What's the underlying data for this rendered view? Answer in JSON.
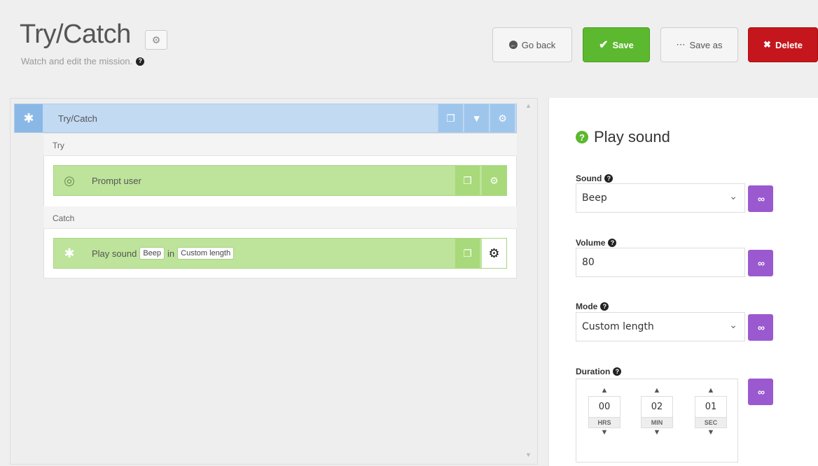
{
  "header": {
    "title": "Try/Catch",
    "subtitle": "Watch and edit the mission.",
    "buttons": {
      "go_back": "Go back",
      "save": "Save",
      "save_as": "Save as",
      "delete": "Delete"
    }
  },
  "mission": {
    "block_title": "Try/Catch",
    "try_label": "Try",
    "catch_label": "Catch",
    "try_action": "Prompt user",
    "catch_action": {
      "label": "Play sound",
      "sound_pill": "Beep",
      "joiner": "in",
      "mode_pill": "Custom length"
    }
  },
  "panel": {
    "title": "Play sound",
    "sound": {
      "label": "Sound",
      "value": "Beep"
    },
    "volume": {
      "label": "Volume",
      "value": "80"
    },
    "mode": {
      "label": "Mode",
      "value": "Custom length"
    },
    "duration": {
      "label": "Duration",
      "hrs": "00",
      "hrs_unit": "HRS",
      "min": "02",
      "min_unit": "MIN",
      "sec": "01",
      "sec_unit": "SEC"
    }
  },
  "colors": {
    "save": "#5cb82e",
    "delete": "#c4161c",
    "block_header": "#c2daf2",
    "action_row": "#bde49a",
    "variable_button": "#9b59d0"
  },
  "icons": [
    "gear-icon",
    "back-arrow-icon",
    "checkmark-icon",
    "ellipsis-icon",
    "close-icon",
    "walking-person-icon",
    "target-icon",
    "copy-icon",
    "chevron-down-icon",
    "question-icon",
    "variable-icon"
  ]
}
